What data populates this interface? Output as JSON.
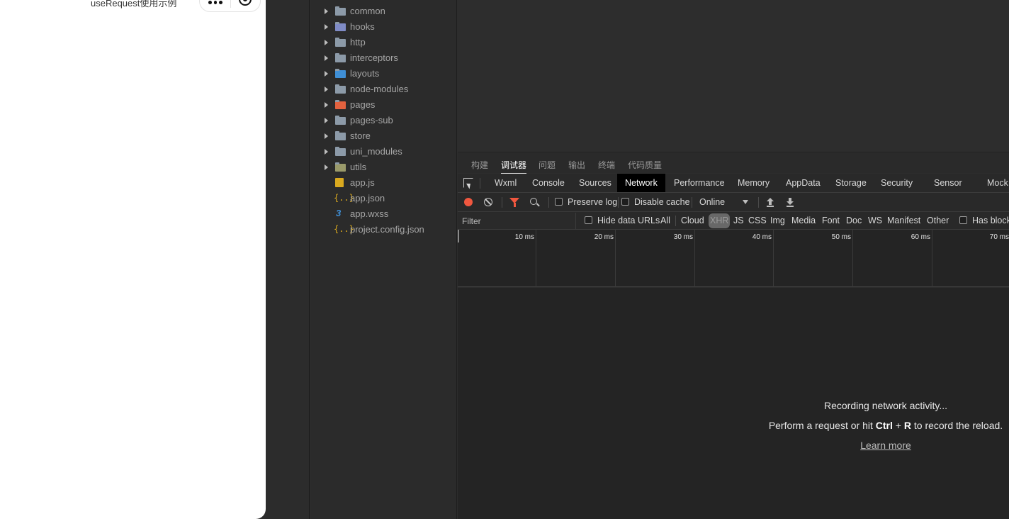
{
  "simulator": {
    "page_title": "useRequest使用示例"
  },
  "explorer": {
    "items": [
      {
        "label": "common",
        "type": "folder",
        "icon": "folder-icon"
      },
      {
        "label": "hooks",
        "type": "folder",
        "icon": "folder-hooks-icon"
      },
      {
        "label": "http",
        "type": "folder",
        "icon": "folder-icon"
      },
      {
        "label": "interceptors",
        "type": "folder",
        "icon": "folder-icon"
      },
      {
        "label": "layouts",
        "type": "folder",
        "icon": "folder-layouts-icon"
      },
      {
        "label": "node-modules",
        "type": "folder",
        "icon": "folder-icon"
      },
      {
        "label": "pages",
        "type": "folder",
        "icon": "folder-pages-icon"
      },
      {
        "label": "pages-sub",
        "type": "folder",
        "icon": "folder-icon"
      },
      {
        "label": "store",
        "type": "folder",
        "icon": "folder-icon"
      },
      {
        "label": "uni_modules",
        "type": "folder",
        "icon": "folder-icon"
      },
      {
        "label": "utils",
        "type": "folder",
        "icon": "folder-utils-icon"
      },
      {
        "label": "app.js",
        "type": "file",
        "icon": "js-file-icon"
      },
      {
        "label": "app.json",
        "type": "file",
        "icon": "json-file-icon"
      },
      {
        "label": "app.wxss",
        "type": "file",
        "icon": "css-file-icon"
      },
      {
        "label": "project.config.json",
        "type": "file",
        "icon": "json-file-icon"
      }
    ]
  },
  "panel_tabs": [
    {
      "label": "构建",
      "active": false
    },
    {
      "label": "调试器",
      "active": true
    },
    {
      "label": "问题",
      "active": false
    },
    {
      "label": "输出",
      "active": false
    },
    {
      "label": "终端",
      "active": false
    },
    {
      "label": "代码质量",
      "active": false
    }
  ],
  "devtools_tabs": [
    {
      "label": "Wxml",
      "active": false
    },
    {
      "label": "Console",
      "active": false
    },
    {
      "label": "Sources",
      "active": false
    },
    {
      "label": "Network",
      "active": true
    },
    {
      "label": "Performance",
      "active": false
    },
    {
      "label": "Memory",
      "active": false
    },
    {
      "label": "AppData",
      "active": false
    },
    {
      "label": "Storage",
      "active": false
    },
    {
      "label": "Security",
      "active": false
    },
    {
      "label": "Sensor",
      "active": false
    },
    {
      "label": "Mock",
      "active": false
    }
  ],
  "network_toolbar": {
    "preserve_log": "Preserve log",
    "disable_cache": "Disable cache",
    "throttling": "Online"
  },
  "filter_bar": {
    "placeholder": "Filter",
    "hide_data_urls": "Hide data URLs",
    "types": [
      {
        "label": "All",
        "active": false
      },
      {
        "label": "Cloud",
        "active": false
      },
      {
        "label": "XHR",
        "active": true
      },
      {
        "label": "JS",
        "active": false
      },
      {
        "label": "CSS",
        "active": false
      },
      {
        "label": "Img",
        "active": false
      },
      {
        "label": "Media",
        "active": false
      },
      {
        "label": "Font",
        "active": false
      },
      {
        "label": "Doc",
        "active": false
      },
      {
        "label": "WS",
        "active": false
      },
      {
        "label": "Manifest",
        "active": false
      },
      {
        "label": "Other",
        "active": false
      }
    ],
    "has_blocked": "Has block"
  },
  "timeline": {
    "ticks": [
      "10 ms",
      "20 ms",
      "30 ms",
      "40 ms",
      "50 ms",
      "60 ms",
      "70 ms"
    ]
  },
  "empty_state": {
    "recording": "Recording network activity...",
    "hint_prefix": "Perform a request or hit ",
    "key1": "Ctrl",
    "plus": " + ",
    "key2": "R",
    "hint_suffix": " to record the reload.",
    "learn_more": "Learn more"
  },
  "colors": {
    "record": "#f0573f",
    "filter_active": "#f0573f",
    "active_tab_bg": "#000000"
  }
}
